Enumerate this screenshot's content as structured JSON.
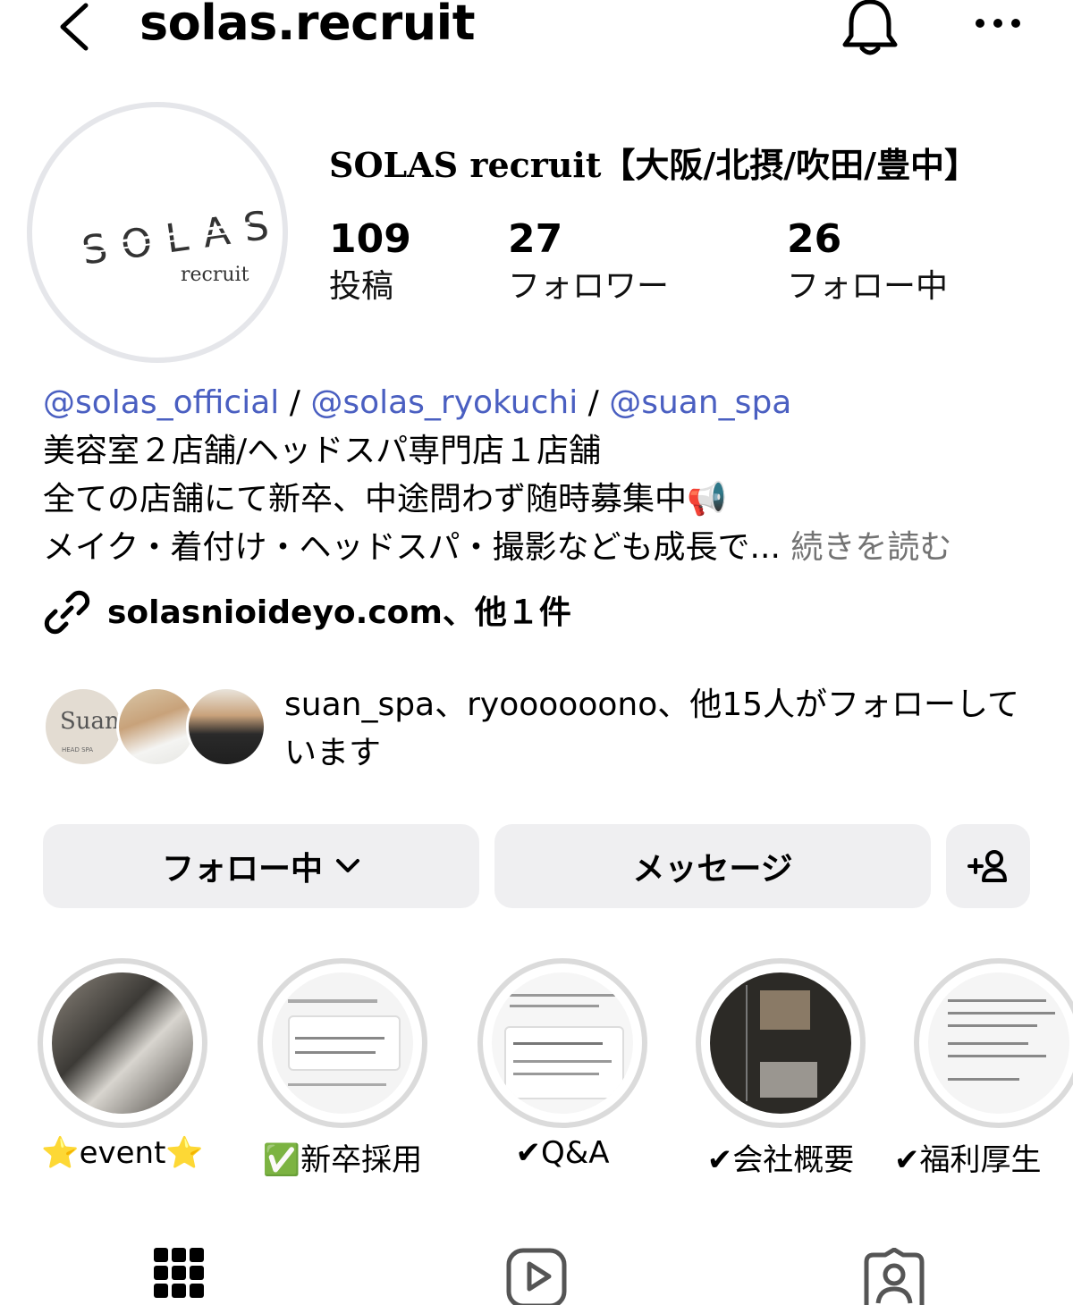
{
  "header": {
    "username": "solas.recruit",
    "back_icon": "chevron-left-icon",
    "bell_icon": "bell-icon",
    "more_icon": "more-horizontal-icon"
  },
  "avatar": {
    "logo_text": "SOLAS",
    "logo_sub": "recruit"
  },
  "profile": {
    "display_name": "SOLAS recruit【大阪/北摂/吹田/豊中】",
    "stats": [
      {
        "value": "109",
        "label": "投稿"
      },
      {
        "value": "27",
        "label": "フォロワー"
      },
      {
        "value": "26",
        "label": "フォロー中"
      }
    ]
  },
  "bio": {
    "mention_1": "@solas_official",
    "sep_1": " / ",
    "mention_2": "@solas_ryokuchi",
    "sep_2": " / ",
    "mention_3": "@suan_spa",
    "line_2": "美容室２店舗/ヘッドスパ専門店１店舗",
    "line_3": "全ての店舗にて新卒、中途問わず随時募集中📢",
    "line_4": "メイク・着付け・ヘッドスパ・撮影なども成長で...",
    "more_label": " 続きを読む"
  },
  "link": {
    "icon": "link-icon",
    "text": "solasnioideyo.com、他１件"
  },
  "followed_by": {
    "text": "suan_spa、ryoooooono、他15人がフォローしています",
    "avatar_1_text": "Suan",
    "avatar_1_sub": "HEAD SPA"
  },
  "actions": {
    "following_label": "フォロー中",
    "message_label": "メッセージ",
    "add_person_icon": "add-person-icon"
  },
  "highlights": [
    {
      "label": "⭐event⭐"
    },
    {
      "label": "✅新卒採用"
    },
    {
      "label": "✔Q&A"
    },
    {
      "label": "✔会社概要"
    },
    {
      "label": "✔福利厚生"
    }
  ],
  "tabs": {
    "grid_icon": "grid-icon",
    "reels_icon": "reels-icon",
    "tagged_icon": "tagged-icon"
  }
}
